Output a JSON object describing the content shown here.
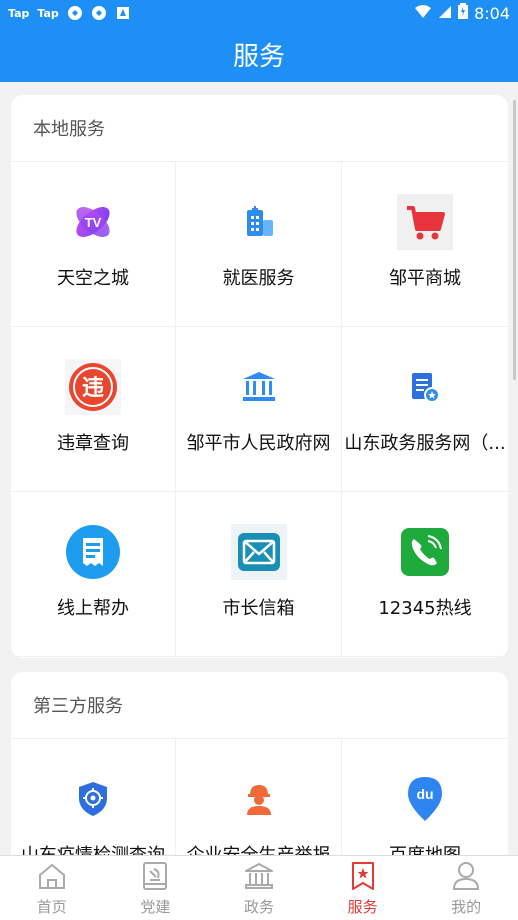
{
  "status_bar": {
    "left_items": [
      "Tap",
      "Tap"
    ],
    "time": "8:04"
  },
  "header": {
    "title": "服务"
  },
  "local_services": {
    "title": "本地服务",
    "items": [
      {
        "label": "天空之城",
        "icon": "tv-icon"
      },
      {
        "label": "就医服务",
        "icon": "hospital-icon"
      },
      {
        "label": "邹平商城",
        "icon": "shopping-cart-icon"
      },
      {
        "label": "违章查询",
        "icon": "violation-icon"
      },
      {
        "label": "邹平市人民政府网",
        "icon": "government-building-icon"
      },
      {
        "label": "山东政务服务网（...",
        "icon": "document-badge-icon"
      },
      {
        "label": "线上帮办",
        "icon": "receipt-icon"
      },
      {
        "label": "市长信箱",
        "icon": "mail-icon"
      },
      {
        "label": "12345热线",
        "icon": "phone-icon"
      }
    ]
  },
  "third_party_services": {
    "title": "第三方服务",
    "items": [
      {
        "label": "山东疫情检测查询",
        "icon": "shield-target-icon"
      },
      {
        "label": "企业安全生产举报",
        "icon": "worker-icon"
      },
      {
        "label": "百度地图",
        "icon": "baidu-map-icon"
      }
    ]
  },
  "tab_bar": {
    "tabs": [
      {
        "label": "首页",
        "icon": "home-icon"
      },
      {
        "label": "党建",
        "icon": "party-icon"
      },
      {
        "label": "政务",
        "icon": "government-icon"
      },
      {
        "label": "服务",
        "icon": "bookmark-star-icon",
        "active": true
      },
      {
        "label": "我的",
        "icon": "user-icon"
      }
    ]
  },
  "colors": {
    "primary": "#1e90f5",
    "active_tab": "#e53935"
  }
}
